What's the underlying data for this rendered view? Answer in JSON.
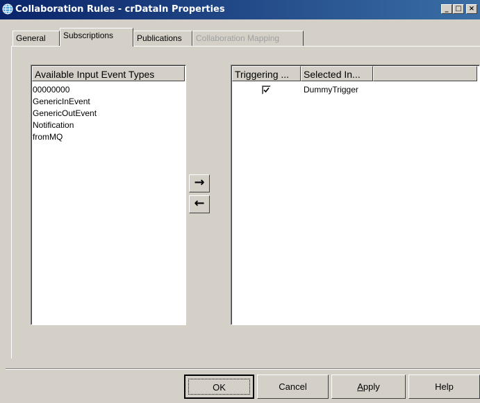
{
  "window": {
    "title": "Collaboration Rules - crDataIn Properties",
    "controls": {
      "minimize": "_",
      "maximize": "□",
      "close": "×"
    }
  },
  "tabs": [
    {
      "label": "General",
      "state": "normal"
    },
    {
      "label": "Subscriptions",
      "state": "active"
    },
    {
      "label": "Publications",
      "state": "normal"
    },
    {
      "label": "Collaboration Mapping",
      "state": "disabled"
    }
  ],
  "available_list": {
    "header": "Available Input Event Types",
    "items": [
      "00000000",
      "GenericInEvent",
      "GenericOutEvent",
      "Notification",
      "fromMQ"
    ]
  },
  "move_buttons": {
    "add": "→",
    "remove": "←"
  },
  "selected_table": {
    "columns": [
      "Triggering ...",
      "Selected In..."
    ],
    "rows": [
      {
        "triggering": true,
        "name": "DummyTrigger"
      }
    ]
  },
  "footer": {
    "ok": "OK",
    "cancel": "Cancel",
    "apply_mnemonic": "A",
    "apply_rest": "pply",
    "help": "Help"
  },
  "colors": {
    "titlebar_start": "#0a246a",
    "titlebar_end": "#3a6ea5",
    "face": "#d4d0c8"
  }
}
